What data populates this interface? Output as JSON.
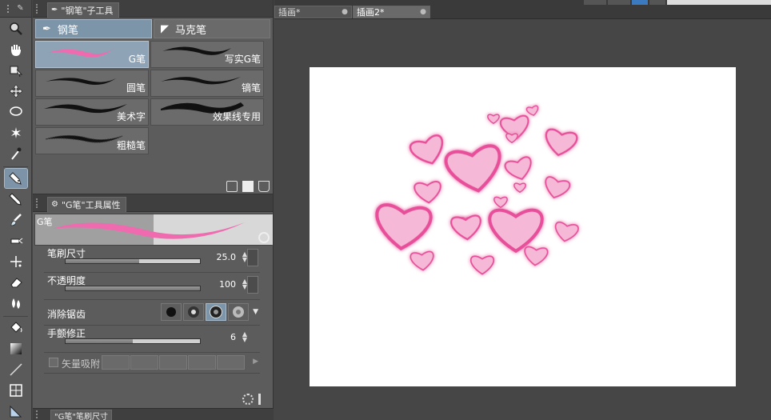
{
  "subtool_panel": {
    "title": "\"钢笔\"子工具",
    "groups": [
      {
        "label": "钢笔",
        "icon": "pen-nib-icon"
      },
      {
        "label": "马克笔",
        "icon": "marker-icon"
      }
    ],
    "brushes": [
      {
        "label": "G笔"
      },
      {
        "label": "写实G笔"
      },
      {
        "label": "圆笔"
      },
      {
        "label": "镝笔"
      },
      {
        "label": "美术字"
      },
      {
        "label": "效果线专用"
      },
      {
        "label": "粗糙笔"
      }
    ]
  },
  "tool_property": {
    "title": "\"G笔\"工具属性",
    "preview_label": "G笔",
    "brush_size": {
      "label": "笔刷尺寸",
      "value": "25.0",
      "fraction": 0.55
    },
    "opacity": {
      "label": "不透明度",
      "value": "100",
      "fraction": 1.0
    },
    "antialias": {
      "label": "消除锯齿",
      "selected_index": 2
    },
    "stabilization": {
      "label": "手颤修正",
      "value": "6",
      "fraction": 0.5
    },
    "vector_snap": {
      "label": "矢量吸附"
    }
  },
  "bottom_panel": {
    "title": "\"G笔\"笔刷尺寸"
  },
  "documents": {
    "tabs": [
      {
        "label": "插画*"
      },
      {
        "label": "插画2*"
      }
    ]
  },
  "colors": {
    "accent": "#7d95a9",
    "heart_fill": "#f5b8d6",
    "heart_stroke": "#e84f9a"
  }
}
